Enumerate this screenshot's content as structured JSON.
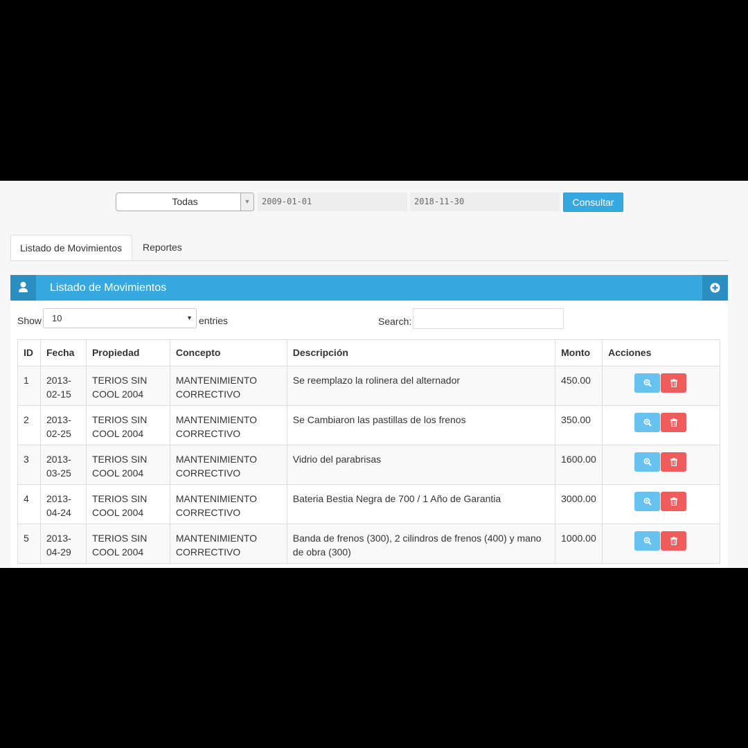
{
  "filters": {
    "property_select": "Todas",
    "date_from": "2009-01-01",
    "date_to": "2018-11-30",
    "submit_label": "Consultar"
  },
  "tabs": [
    {
      "label": "Listado de Movimientos",
      "active": true
    },
    {
      "label": "Reportes",
      "active": false
    }
  ],
  "panel": {
    "title": "Listado de Movimientos",
    "user_icon": "user-icon",
    "add_icon": "plus-circle-icon"
  },
  "table_controls": {
    "show_label": "Show",
    "entries_value": "10",
    "entries_label": "entries",
    "search_label": "Search:",
    "search_value": ""
  },
  "table": {
    "headers": [
      "ID",
      "Fecha",
      "Propiedad",
      "Concepto",
      "Descripción",
      "Monto",
      "Acciones"
    ],
    "rows": [
      {
        "id": "1",
        "fecha_1": "2013-",
        "fecha_2": "02-15",
        "prop_1": "TERIOS SIN",
        "prop_2": "COOL 2004",
        "concepto_1": "MANTENIMIENTO",
        "concepto_2": "CORRECTIVO",
        "descripcion": "Se reemplazo la rolinera del alternador",
        "monto": "450.00"
      },
      {
        "id": "2",
        "fecha_1": "2013-",
        "fecha_2": "02-25",
        "prop_1": "TERIOS SIN",
        "prop_2": "COOL 2004",
        "concepto_1": "MANTENIMIENTO",
        "concepto_2": "CORRECTIVO",
        "descripcion": "Se Cambiaron las pastillas de los frenos",
        "monto": "350.00"
      },
      {
        "id": "3",
        "fecha_1": "2013-",
        "fecha_2": "03-25",
        "prop_1": "TERIOS SIN",
        "prop_2": "COOL 2004",
        "concepto_1": "MANTENIMIENTO",
        "concepto_2": "CORRECTIVO",
        "descripcion": "Vidrio del parabrisas",
        "monto": "1600.00"
      },
      {
        "id": "4",
        "fecha_1": "2013-",
        "fecha_2": "04-24",
        "prop_1": "TERIOS SIN",
        "prop_2": "COOL 2004",
        "concepto_1": "MANTENIMIENTO",
        "concepto_2": "CORRECTIVO",
        "descripcion": "Bateria Bestia Negra de 700 / 1 Año de Garantia",
        "monto": "3000.00"
      },
      {
        "id": "5",
        "fecha_1": "2013-",
        "fecha_2": "04-29",
        "prop_1": "TERIOS SIN",
        "prop_2": "COOL 2004",
        "concepto_1": "MANTENIMIENTO",
        "concepto_2": "CORRECTIVO",
        "descripcion": "Banda de frenos (300), 2 cilindros de frenos (400) y mano de obra (300)",
        "monto": "1000.00"
      }
    ]
  },
  "colors": {
    "accent": "#36a9e1",
    "accent_dark": "#2b8fc2",
    "view_button": "#67c2ef",
    "delete_button": "#f05b5b"
  }
}
